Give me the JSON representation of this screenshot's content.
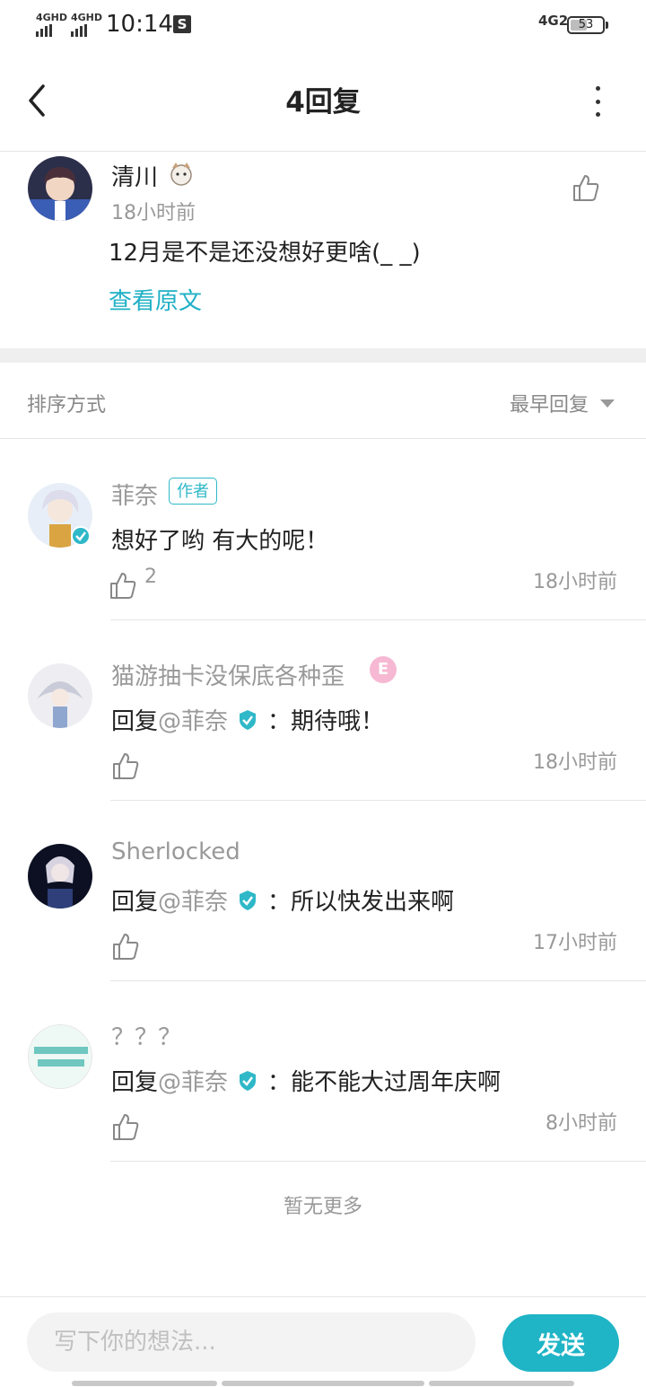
{
  "status_bar": {
    "network_left_1": "4GHD",
    "network_left_2": "4GHD",
    "time": "10:14",
    "network_right": "4G2",
    "battery": "53",
    "battery_level": 0.53
  },
  "nav": {
    "title": "4回复"
  },
  "original_comment": {
    "author": "清川",
    "time": "18小时前",
    "text": "12月是不是还没想好更啥(_ _)",
    "view_original": "查看原文"
  },
  "sort": {
    "label": "排序方式",
    "value": "最早回复"
  },
  "replies": [
    {
      "name": "菲奈",
      "tag": "作者",
      "content": "想好了哟 有大的呢！",
      "likes": "2",
      "time": "18小时前"
    },
    {
      "name": "猫游抽卡没保底各种歪",
      "badge": "E",
      "reply_prefix": "回复",
      "mention": "@菲奈",
      "content": "：期待哦！",
      "time": "18小时前"
    },
    {
      "name": "Sherlocked",
      "reply_prefix": "回复",
      "mention": "@菲奈",
      "content": "：所以快发出来啊",
      "time": "17小时前"
    },
    {
      "name": "？？？",
      "reply_prefix": "回复",
      "mention": "@菲奈",
      "content": "：能不能大过周年庆啊",
      "time": "8小时前"
    }
  ],
  "no_more": "暂无更多",
  "composer": {
    "placeholder": "写下你的想法...",
    "send": "发送"
  },
  "colors": {
    "accent": "#1fb4c6",
    "verified": "#2fb8c8",
    "muted_text": "#999999",
    "primary_text": "#222222"
  }
}
